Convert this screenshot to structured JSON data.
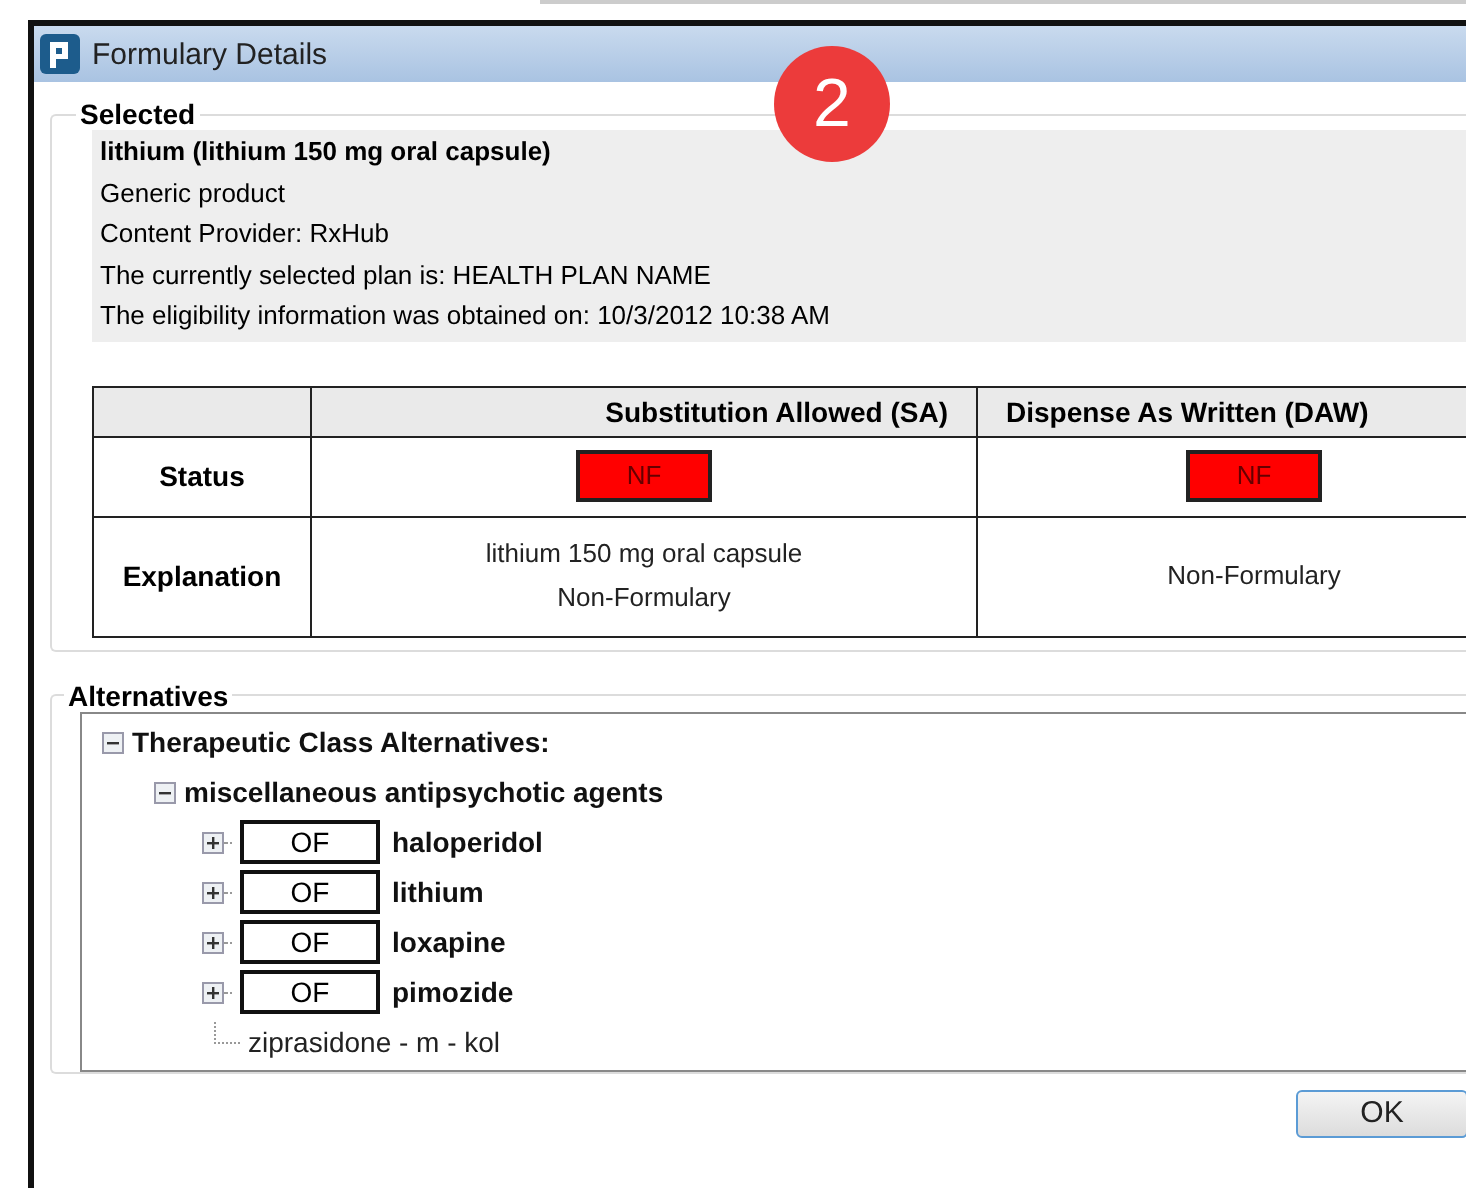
{
  "window": {
    "title": "Formulary Details"
  },
  "badge": "2",
  "selected": {
    "legend": "Selected",
    "drug": "lithium (lithium 150 mg oral capsule)",
    "lines": [
      "Generic product",
      "Content Provider: RxHub",
      "The currently selected plan is: HEALTH PLAN NAME",
      "The eligibility information was obtained on: 10/3/2012 10:38 AM"
    ]
  },
  "table": {
    "columns": [
      "Substitution Allowed (SA)",
      "Dispense As Written (DAW)"
    ],
    "status": {
      "label": "Status",
      "cells": [
        {
          "text": "NF",
          "color": "#ff0000"
        },
        {
          "text": "NF",
          "color": "#ff0000"
        }
      ]
    },
    "explanation": {
      "label": "Explanation",
      "cells": [
        [
          "lithium 150 mg oral capsule",
          "Non-Formulary"
        ],
        [
          "Non-Formulary"
        ]
      ]
    }
  },
  "alternatives": {
    "legend": "Alternatives",
    "tree": [
      {
        "label": "Therapeutic Class Alternatives:",
        "kind": "group",
        "expanded": true,
        "children": [
          {
            "label": "miscellaneous antipsychotic agents",
            "kind": "group",
            "expanded": true,
            "children": [
              {
                "label": "haloperidol",
                "kind": "drug",
                "status": "OF",
                "expanded": false
              },
              {
                "label": "lithium",
                "kind": "drug",
                "status": "OF",
                "expanded": false
              },
              {
                "label": "loxapine",
                "kind": "drug",
                "status": "OF",
                "expanded": false
              },
              {
                "label": "pimozide",
                "kind": "drug",
                "status": "OF",
                "expanded": false
              },
              {
                "label": "ziprasidone - m - kol",
                "kind": "leaf"
              }
            ]
          }
        ]
      }
    ]
  },
  "buttons": [
    "OK"
  ]
}
